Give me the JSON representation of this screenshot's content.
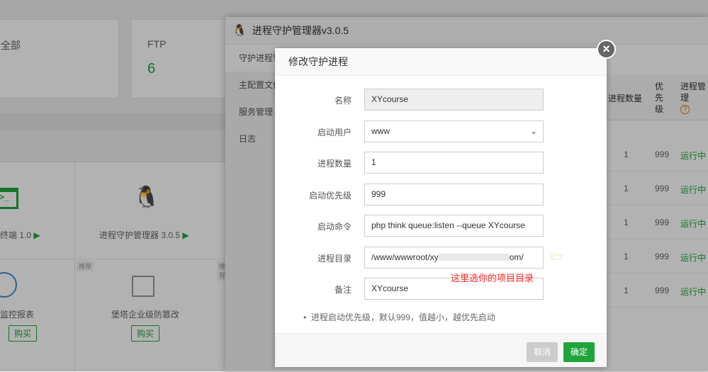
{
  "background": {
    "cards": [
      {
        "title": "全部",
        "value": ""
      },
      {
        "title": "FTP",
        "value": "6"
      }
    ],
    "plugins": [
      {
        "name": "终端 1.0"
      },
      {
        "name": "进程守护管理器 3.0.5"
      }
    ],
    "paid": [
      {
        "name": "监控报表",
        "buy": "购买"
      },
      {
        "name": "堡塔企业级防篡改",
        "buy": "购买",
        "tag": "推荐"
      }
    ],
    "tag2": "推荐"
  },
  "window": {
    "title": "进程守护管理器v3.0.5",
    "menu": [
      "守护进程管理",
      "主配置文件",
      "服务管理",
      "日志"
    ],
    "table": {
      "headers": [
        "进程数量",
        "优先级",
        "进程管理"
      ],
      "rows": [
        {
          "count": "1",
          "priority": "999",
          "status": "运行中"
        },
        {
          "count": "1",
          "priority": "999",
          "status": "运行中"
        },
        {
          "count": "1",
          "priority": "999",
          "status": "运行中"
        },
        {
          "count": "1",
          "priority": "999",
          "status": "运行中"
        },
        {
          "count": "1",
          "priority": "999",
          "status": "运行中"
        }
      ]
    }
  },
  "modal": {
    "title": "修改守护进程",
    "fields": [
      {
        "label": "名称",
        "value": "XYcourse"
      },
      {
        "label": "启动用户",
        "value": "www"
      },
      {
        "label": "进程数量",
        "value": "1"
      },
      {
        "label": "启动优先级",
        "value": "999"
      },
      {
        "label": "启动命令",
        "value": "php think queue:listen --queue XYcourse"
      },
      {
        "label": "进程目录",
        "value": "/www/wwwroot/xy",
        "value_tail": "om/"
      },
      {
        "label": "备注",
        "value": "XYcourse"
      }
    ],
    "annotation": "这里选你的项目目录",
    "tip": "进程启动优先级，默认999，值越小，越优先启动",
    "cancel": "取消",
    "confirm": "确定",
    "colors": {
      "accent": "#20a53a",
      "annotation": "#ff2a2a"
    }
  }
}
